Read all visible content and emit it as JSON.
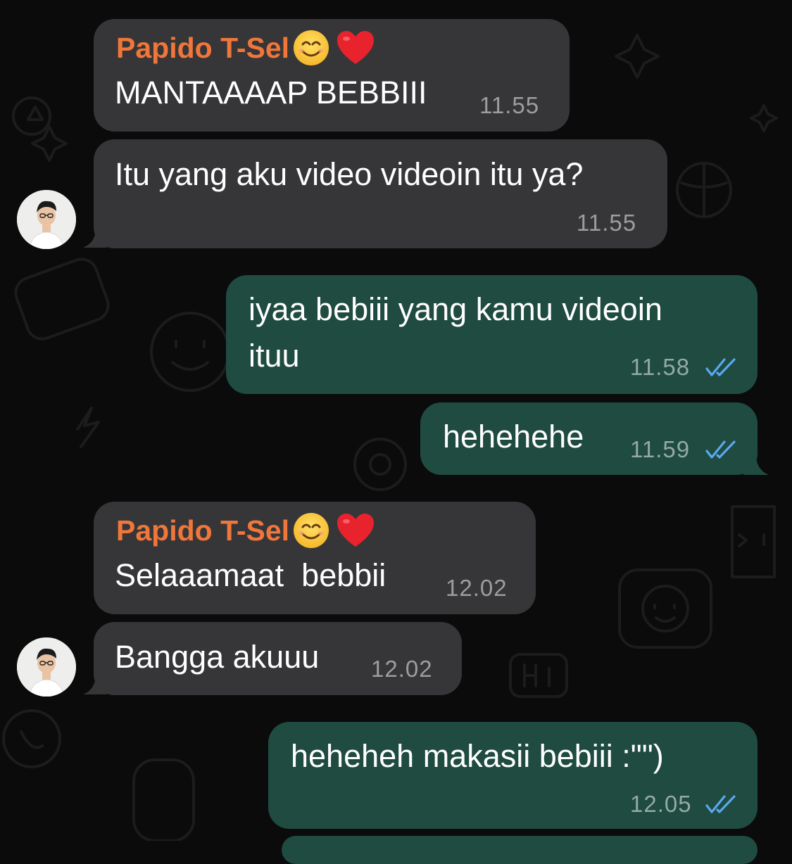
{
  "chat": {
    "messages": [
      {
        "sender": "Papido T-Sel",
        "text": "MANTAAAAP BEBBIII",
        "time": "11.55"
      },
      {
        "text": "Itu yang aku video videoin itu ya?",
        "time": "11.55"
      },
      {
        "text": "iyaa bebiii yang kamu videoin\nituu",
        "time": "11.58",
        "status": "read"
      },
      {
        "text": "hehehehe",
        "time": "11.59",
        "status": "read"
      },
      {
        "sender": "Papido T-Sel",
        "text": "Selaaamaat  bebbii",
        "time": "12.02"
      },
      {
        "text": "Bangga akuuu",
        "time": "12.02"
      },
      {
        "text": "heheheh makasii bebiii :\"\")",
        "time": "12.05",
        "status": "read"
      }
    ]
  },
  "icons": {
    "smile_emoji": "smiling-face-emoji",
    "heart_emoji": "red-heart-emoji",
    "read_ticks": "double-check-icon"
  },
  "colors": {
    "background": "#0b0b0b",
    "incoming_bubble": "#363638",
    "outgoing_bubble": "#1f4b40",
    "sender_name": "#f0763a",
    "read_ticks": "#5aa8f0",
    "timestamp": "#9d9da0"
  }
}
